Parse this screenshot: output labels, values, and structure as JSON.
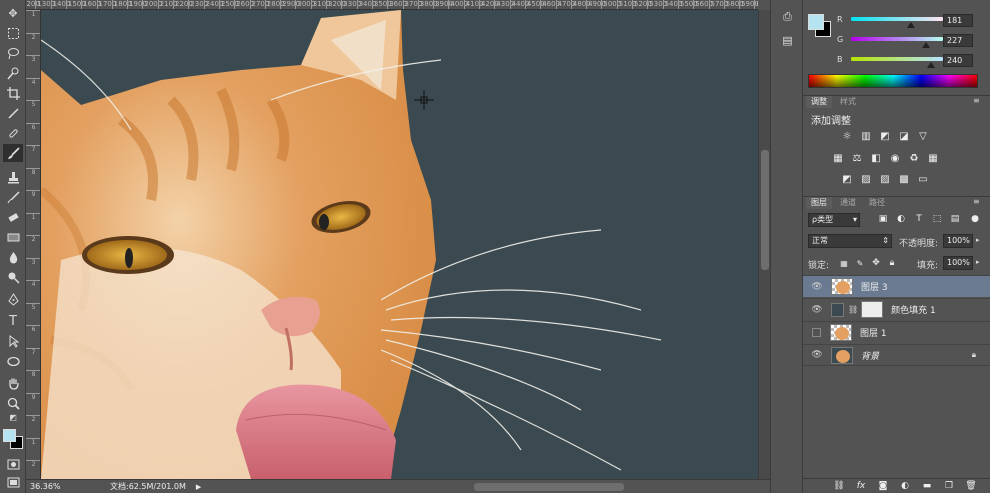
{
  "toolbar": {
    "tools": [
      "move-tool",
      "marquee-tool",
      "lasso-tool",
      "quick-select-tool",
      "crop-tool",
      "eyedropper-tool",
      "healing-brush-tool",
      "brush-tool",
      "clone-stamp-tool",
      "history-brush-tool",
      "eraser-tool",
      "gradient-tool",
      "blur-tool",
      "dodge-tool",
      "pen-tool",
      "type-tool",
      "path-select-tool",
      "shape-tool",
      "hand-tool",
      "zoom-tool"
    ],
    "colors": {
      "foreground": "#b5e3f0",
      "background": "#000000"
    }
  },
  "ruler": {
    "top_ticks": [
      "1200",
      "1300",
      "1400",
      "1500",
      "1600",
      "1700",
      "1800",
      "1900",
      "2000",
      "2100",
      "2200",
      "2300",
      "2400",
      "2500",
      "2600",
      "2700",
      "2800",
      "2900",
      "3000",
      "3100",
      "3200",
      "3300",
      "3400",
      "3500",
      "3600",
      "3700",
      "3800",
      "3900",
      "4000",
      "4100",
      "4200",
      "4300",
      "4400",
      "4500",
      "4600",
      "4700",
      "4800",
      "4900",
      "5000",
      "5100",
      "5200",
      "5300",
      "5400",
      "5500",
      "5600",
      "5700",
      "5800",
      "5900",
      "6000",
      "6100"
    ],
    "left_ticks": [
      "1",
      "2",
      "3",
      "4",
      "5",
      "6",
      "7",
      "8",
      "9",
      "1",
      "2",
      "3",
      "4",
      "5",
      "6",
      "7",
      "8",
      "9",
      "2",
      "1",
      "2"
    ]
  },
  "status": {
    "zoom": "36.36%",
    "doc_label": "文档:62.5M/201.0M"
  },
  "color_panel": {
    "channels": [
      {
        "label": "R",
        "value": "181"
      },
      {
        "label": "G",
        "value": "227"
      },
      {
        "label": "B",
        "value": "240"
      }
    ],
    "fg_color": "#b5e3f0"
  },
  "adjustments_panel": {
    "tabs": [
      "调整",
      "样式"
    ],
    "title": "添加调整"
  },
  "layers_panel": {
    "tabs": [
      "图层",
      "通道",
      "路径"
    ],
    "filter": "ρ类型",
    "blend_mode": "正常",
    "opacity_label": "不透明度:",
    "opacity_value": "100%",
    "lock_label": "锁定:",
    "fill_label": "填充:",
    "fill_value": "100%",
    "layers": [
      {
        "name": "图层 3",
        "visible": true,
        "selected": true
      },
      {
        "name": "颜色填充 1",
        "visible": true,
        "selected": false
      },
      {
        "name": "图层 1",
        "visible": false,
        "selected": false
      },
      {
        "name": "背景",
        "visible": true,
        "selected": false,
        "locked": true
      }
    ]
  },
  "canvas": {
    "background": "#3a4a50"
  }
}
